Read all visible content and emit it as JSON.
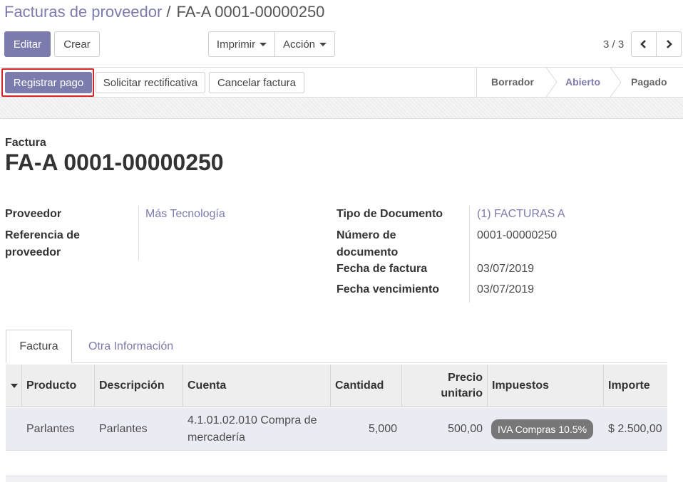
{
  "breadcrumb": {
    "parent": "Facturas de proveedor",
    "separator": "/",
    "current": "FA-A 0001-00000250"
  },
  "control_panel": {
    "edit_label": "Editar",
    "create_label": "Crear",
    "print_label": "Imprimir",
    "action_label": "Acción",
    "pager_value": "3 / 3"
  },
  "statusbar": {
    "register_payment": "Registrar pago",
    "request_credit_note": "Solicitar rectificativa",
    "cancel_invoice": "Cancelar factura",
    "states": [
      {
        "label": "Borrador",
        "active": false
      },
      {
        "label": "Abierto",
        "active": true
      },
      {
        "label": "Pagado",
        "active": false
      }
    ]
  },
  "document": {
    "type_label": "Factura",
    "number": "FA-A 0001-00000250"
  },
  "fields": {
    "supplier_label": "Proveedor",
    "supplier_value": "Más Tecnología",
    "supplier_ref_label_line1": "Referencia de",
    "supplier_ref_label_line2": "proveedor",
    "doc_type_label": "Tipo de Documento",
    "doc_type_value": "(1) FACTURAS A",
    "doc_number_label_line1": "Número de",
    "doc_number_label_line2": "documento",
    "doc_number_value": "0001-00000250",
    "invoice_date_label": "Fecha de factura",
    "invoice_date_value": "03/07/2019",
    "due_date_label": "Fecha vencimiento",
    "due_date_value": "03/07/2019"
  },
  "tabs": {
    "invoice": "Factura",
    "other_info": "Otra Información"
  },
  "table": {
    "headers": {
      "product": "Producto",
      "description": "Descripción",
      "account": "Cuenta",
      "quantity": "Cantidad",
      "unit_price_line1": "Precio",
      "unit_price_line2": "unitario",
      "taxes": "Impuestos",
      "amount": "Importe"
    },
    "rows": [
      {
        "product": "Parlantes",
        "description": "Parlantes",
        "account_line1": "4.1.01.02.010 Compra de",
        "account_line2": "mercadería",
        "quantity": "5,000",
        "unit_price": "500,00",
        "tax_badge": "IVA Compras 10.5%",
        "amount": "$ 2.500,00"
      }
    ]
  },
  "colors": {
    "accent": "#7c7bad",
    "highlight": "#d6262a",
    "row_selected": "#ebebf4"
  }
}
